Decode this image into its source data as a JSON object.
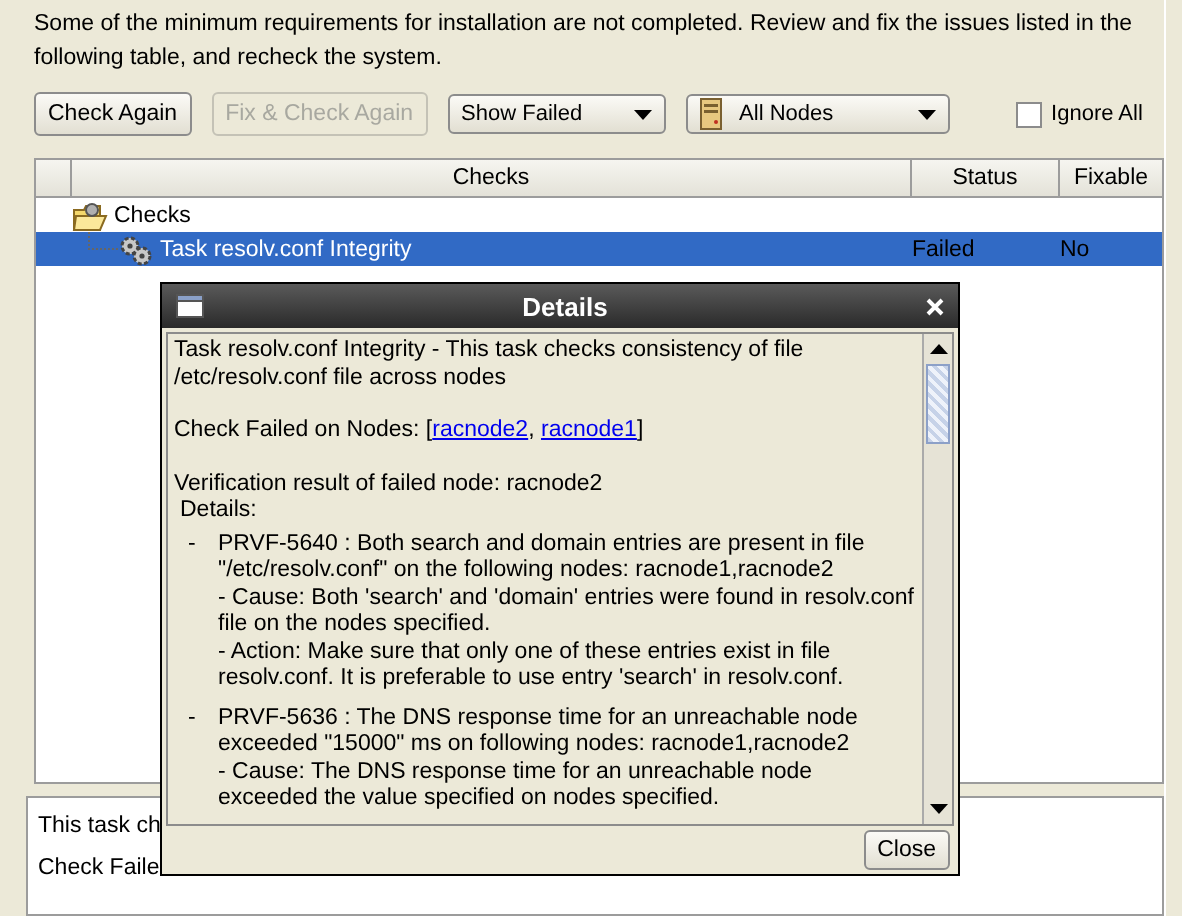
{
  "message": "Some of the minimum requirements for installation are not completed. Review and fix the issues listed in the following table, and recheck the system.",
  "toolbar": {
    "buttons": [
      {
        "label": "Check Again",
        "disabled": false
      },
      {
        "label": "Fix & Check Again",
        "disabled": true
      }
    ],
    "filter": {
      "value": "Show Failed"
    },
    "nodes": {
      "value": "All Nodes"
    },
    "ignore_all": {
      "label": "Ignore All",
      "checked": false
    }
  },
  "table": {
    "columns": [
      "Checks",
      "Status",
      "Fixable"
    ],
    "tree": [
      {
        "label": "Checks",
        "expanded": true,
        "children": [
          {
            "label": "Task resolv.conf Integrity",
            "status": "Failed",
            "fixable": "No",
            "selected": true
          }
        ]
      }
    ]
  },
  "bottom_panel": {
    "lines": [
      "This task ch",
      "Check Faile"
    ]
  },
  "dialog": {
    "title": "Details",
    "blocks": [
      {
        "kind": "text",
        "text": "Task resolv.conf Integrity - This task checks consistency of file /etc/resolv.conf file across nodes"
      },
      {
        "kind": "links",
        "label": "Check Failed on Nodes: [",
        "links": [
          "racnode2",
          "racnode1"
        ],
        "separator": ", ",
        "end": "]"
      },
      {
        "kind": "text",
        "text": "Verification result of failed node: racnode2"
      },
      {
        "kind": "heading",
        "text": "Details:"
      },
      {
        "kind": "issue",
        "bullet": "-",
        "text": "PRVF-5640 : Both search and domain entries are present in file \"/etc/resolv.conf\" on the following nodes: racnode1,racnode2",
        "cause": "- Cause:  Both 'search' and 'domain' entries were found in resolv.conf file on the nodes specified.",
        "action": "- Action:  Make sure that only one of these entries exist in file resolv.conf. It is preferable to use entry 'search' in resolv.conf."
      },
      {
        "kind": "issue",
        "bullet": "-",
        "text": "PRVF-5636 : The DNS response time for an unreachable node exceeded \"15000\" ms on following nodes: racnode1,racnode2",
        "cause": "- Cause:  The DNS response time for an unreachable node exceeded the value specified on nodes specified."
      }
    ],
    "close": "Close"
  }
}
